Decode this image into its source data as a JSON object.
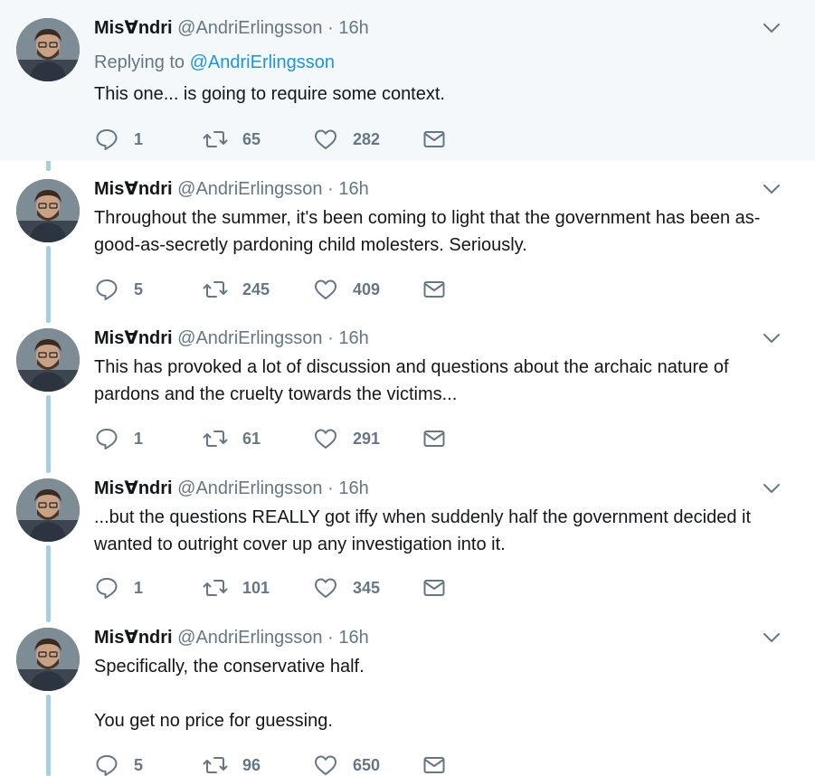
{
  "tweets": [
    {
      "name": "Mis∀ndri",
      "handle": "@AndriErlingsson",
      "dot": "·",
      "time": "16h",
      "replying_prefix": "Replying to",
      "replying_handle": "@AndriErlingsson",
      "text": [
        "This one... is going to require some context."
      ],
      "replies": "1",
      "retweets": "65",
      "likes": "282"
    },
    {
      "name": "Mis∀ndri",
      "handle": "@AndriErlingsson",
      "dot": "·",
      "time": "16h",
      "text": [
        "Throughout the summer, it's been coming to light that the government has been as-good-as-secretly pardoning child molesters. Seriously."
      ],
      "replies": "5",
      "retweets": "245",
      "likes": "409"
    },
    {
      "name": "Mis∀ndri",
      "handle": "@AndriErlingsson",
      "dot": "·",
      "time": "16h",
      "text": [
        "This has provoked a lot of discussion and questions about the archaic nature of pardons and the cruelty towards the victims..."
      ],
      "replies": "1",
      "retweets": "61",
      "likes": "291"
    },
    {
      "name": "Mis∀ndri",
      "handle": "@AndriErlingsson",
      "dot": "·",
      "time": "16h",
      "text": [
        "...but the questions REALLY got iffy when suddenly half the government decided it wanted to outright cover up any investigation into it."
      ],
      "replies": "1",
      "retweets": "101",
      "likes": "345"
    },
    {
      "name": "Mis∀ndri",
      "handle": "@AndriErlingsson",
      "dot": "·",
      "time": "16h",
      "text": [
        "Specifically, the conservative half.",
        "You get no price for guessing."
      ],
      "replies": "5",
      "retweets": "96",
      "likes": "650"
    }
  ],
  "icons": {
    "reply": "reply-icon",
    "retweet": "retweet-icon",
    "like": "heart-icon",
    "dm": "envelope-icon",
    "caret": "chevron-down-icon"
  },
  "colors": {
    "thread_line": "#a5d0e3",
    "link": "#1b95e0",
    "secondary_text": "#657786",
    "highlight_bg": "#f5f8fa"
  }
}
